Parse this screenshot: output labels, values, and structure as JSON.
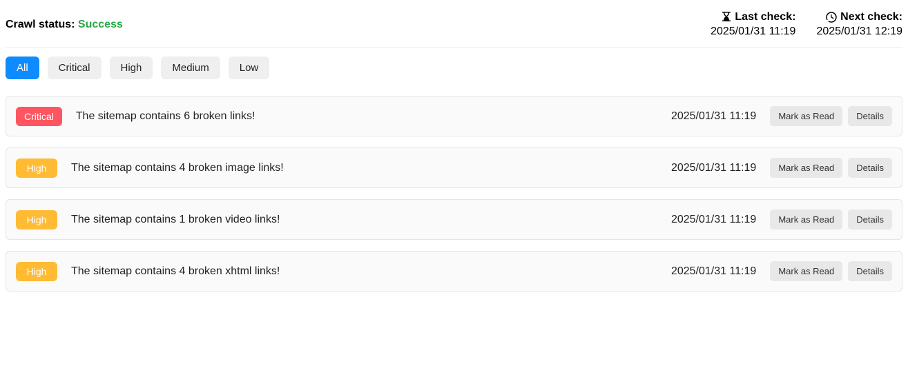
{
  "header": {
    "crawl_status_label": "Crawl status:",
    "crawl_status_value": "Success",
    "last_check_label": "Last check:",
    "last_check_time": "2025/01/31 11:19",
    "next_check_label": "Next check:",
    "next_check_time": "2025/01/31 12:19"
  },
  "filters": {
    "all": "All",
    "critical": "Critical",
    "high": "High",
    "medium": "Medium",
    "low": "Low"
  },
  "buttons": {
    "mark_as_read": "Mark as Read",
    "details": "Details"
  },
  "issues": [
    {
      "severity": "Critical",
      "severity_class": "critical",
      "message": "The sitemap contains 6 broken links!",
      "time": "2025/01/31 11:19"
    },
    {
      "severity": "High",
      "severity_class": "high",
      "message": "The sitemap contains 4 broken image links!",
      "time": "2025/01/31 11:19"
    },
    {
      "severity": "High",
      "severity_class": "high",
      "message": "The sitemap contains 1 broken video links!",
      "time": "2025/01/31 11:19"
    },
    {
      "severity": "High",
      "severity_class": "high",
      "message": "The sitemap contains 4 broken xhtml links!",
      "time": "2025/01/31 11:19"
    }
  ]
}
